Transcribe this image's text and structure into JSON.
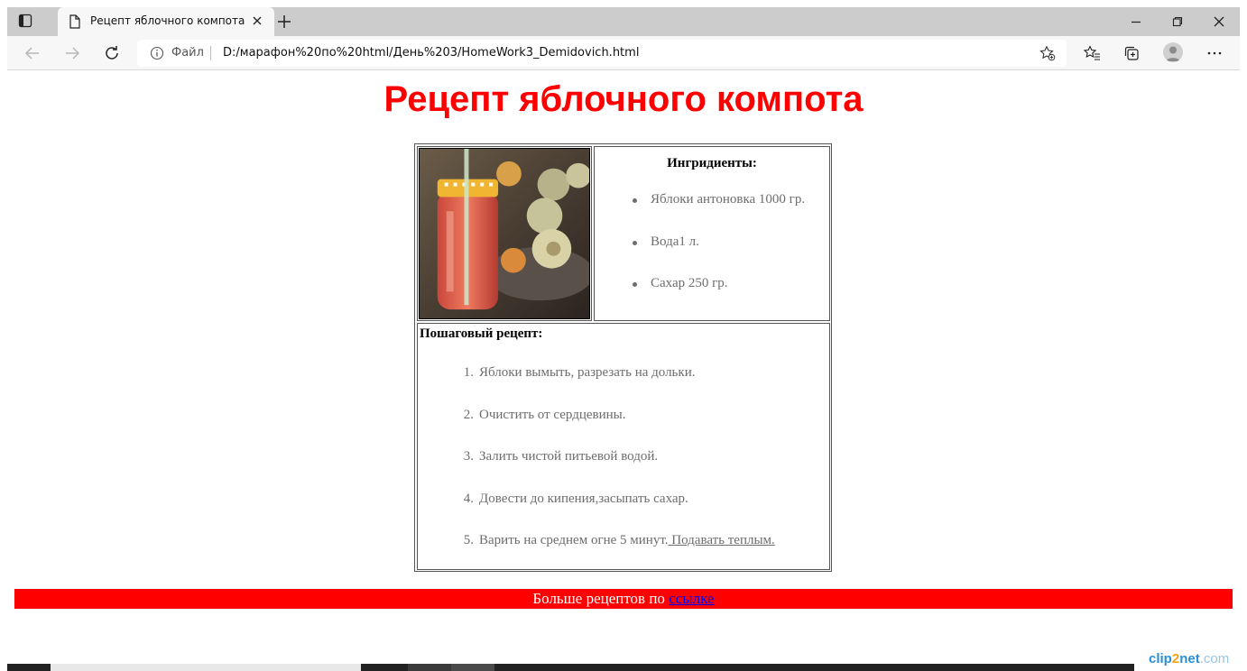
{
  "browser": {
    "tab_title": "Рецепт яблочного компота",
    "new_tab_symbol": "+",
    "address_scheme": "Файл",
    "address_url": "D:/марафон%20по%20html/День%203/HomeWork3_Demidovich.html",
    "more_symbol": "···"
  },
  "page": {
    "title": "Рецепт яблочного компота",
    "title_color": "#ff0000",
    "photo_alt": "Яблочный компот",
    "ingredients_heading": "Ингридиенты:",
    "ingredients": [
      "Яблоки антоновка 1000 гр.",
      "Вода1 л.",
      "Сахар 250 гр."
    ],
    "steps_heading": "Пошаговый рецепт:",
    "steps": [
      {
        "num": "1.",
        "text": "Яблоки вымыть, разрезать на дольки."
      },
      {
        "num": "2.",
        "text": "Очистить от сердцевины."
      },
      {
        "num": "3.",
        "text": "Залить чистой питьевой водой."
      },
      {
        "num": "4.",
        "text": "Довести до кипения,засыпать сахар."
      },
      {
        "num": "5.",
        "text": "Варить на среднем огне 5 минут.",
        "extra": " Подавать теплым."
      }
    ],
    "footer_text": "Больше рецептов по ",
    "footer_link": "ссылке",
    "footer_bg": "#ff0000"
  },
  "watermark": {
    "part1": "clip",
    "part2": "2",
    "part3": "net",
    "part4": ".com"
  },
  "icons": {
    "tab_actions": "tab-actions-icon",
    "page": "page-icon",
    "close": "close-icon",
    "minimize": "minimize-icon",
    "restore": "restore-icon",
    "back": "back-arrow-icon",
    "forward": "forward-arrow-icon",
    "refresh": "refresh-icon",
    "info": "info-icon",
    "add_favorite": "add-favorite-icon",
    "favorites": "favorites-icon",
    "collections": "collections-icon",
    "profile": "profile-icon",
    "more": "more-icon"
  }
}
